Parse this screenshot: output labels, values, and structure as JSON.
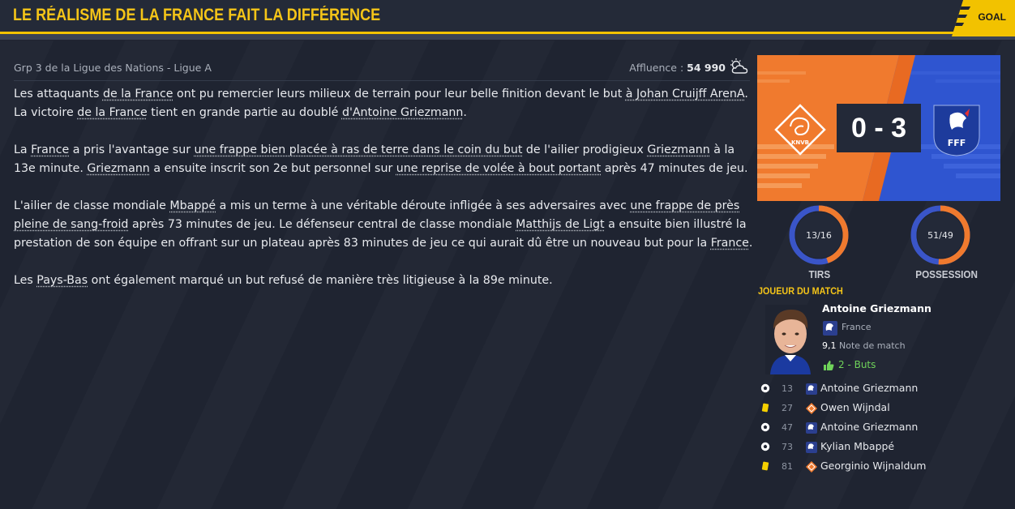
{
  "header": {
    "title": "LE RÉALISME DE LA FRANCE FAIT LA DIFFÉRENCE",
    "tab_label": "GOAL"
  },
  "match_info": {
    "competition": "Grp 3 de la Ligue des Nations - Ligue A",
    "attendance_label": "Affluence :",
    "attendance_value": "54 990",
    "weather_icon": "partly-cloudy-icon"
  },
  "article": {
    "p1": {
      "t1": "Les attaquants ",
      "l1": "de la France",
      "t2": " ont pu remercier leurs milieux de terrain pour leur belle finition devant le but ",
      "l2": "à Johan Cruijff ArenA",
      "t3": ". La victoire ",
      "l3": "de la France",
      "t4": " tient en grande partie au doublé ",
      "l4": "d'Antoine Griezmann",
      "t5": "."
    },
    "p2": {
      "t1": "La ",
      "l1": "France",
      "t2": " a pris l'avantage sur ",
      "l2": "une frappe bien placée à ras de terre dans le coin du but",
      "t3": " de l'ailier prodigieux ",
      "l3": "Griezmann",
      "t4": " à la 13e minute. ",
      "l4": "Griezmann",
      "t5": " a ensuite inscrit son 2e but personnel sur ",
      "l5": "une reprise de volée à bout portant",
      "t6": " après 47 minutes de jeu."
    },
    "p3": {
      "t1": "L'ailier de classe mondiale ",
      "l1": "Mbappé",
      "t2": " a mis un terme à une véritable déroute infligée à ses adversaires avec ",
      "l2": "une frappe de près pleine de sang-froid",
      "t3": " après 73 minutes de jeu. Le défenseur central de classe mondiale ",
      "l3": "Matthijs de Ligt",
      "t4": " a ensuite bien illustré la prestation de son équipe en offrant sur un plateau après 83 minutes de jeu ce qui aurait dû être un nouveau but pour la ",
      "l4": "France",
      "t5": "."
    },
    "p4": {
      "t1": "Les ",
      "l1": "Pays-Bas",
      "t2": " ont également marqué un but refusé de manière très litigieuse à la 89e minute."
    }
  },
  "scoreboard": {
    "home_badge": "KNVB",
    "away_badge": "FFF",
    "score": "0 - 3",
    "home_color": "#f07a2e",
    "away_color": "#2f55d0"
  },
  "stats": {
    "shots": {
      "value": "13/16",
      "label": "TIRS",
      "home_fraction": 0.448
    },
    "possession": {
      "value": "51/49",
      "label": "POSSESSION",
      "home_fraction": 0.51
    }
  },
  "potm": {
    "title": "JOUEUR DU MATCH",
    "name": "Antoine Griezmann",
    "club": "France",
    "rating": "9,1",
    "rating_label": "Note de match",
    "goals": "2 - Buts"
  },
  "events": [
    {
      "minute": "13",
      "icon": "ball-icon",
      "team": "france",
      "player": "Antoine Griezmann"
    },
    {
      "minute": "27",
      "icon": "yellow-card-icon",
      "team": "netherlands",
      "player": "Owen Wijndal"
    },
    {
      "minute": "47",
      "icon": "ball-icon",
      "team": "france",
      "player": "Antoine Griezmann"
    },
    {
      "minute": "73",
      "icon": "ball-icon",
      "team": "france",
      "player": "Kylian Mbappé"
    },
    {
      "minute": "81",
      "icon": "yellow-card-icon",
      "team": "netherlands",
      "player": "Georginio Wijnaldum"
    }
  ]
}
